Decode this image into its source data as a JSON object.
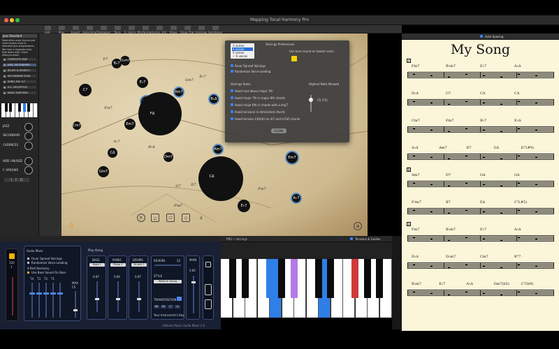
{
  "window": {
    "title": "Mapping Tonal Harmony Pro"
  },
  "toolbar": {
    "items": [
      "Edit",
      "Play",
      "Export",
      "Auto-Arrange",
      "Transpose",
      "Tools",
      "E. Harm. Markers",
      "Performance",
      "Lyrics, Info",
      "Show",
      "Show Transposition",
      "Voicings",
      "Semitones"
    ]
  },
  "left_panel": {
    "song": "Jazz Standard",
    "help": "Most often used chords and chord scales used in standard jazz progressions. We have a separate map that deals with 'Giant' idiosyncrasies.",
    "menu": [
      "COMPLETE MAP",
      "ADV. SECONDARY",
      "BLUES & MODES+",
      "SECONDARY DOM.",
      "SUBS, INC. b7",
      "II-V, DECEPTIVE",
      "BASIC DIATONIC"
    ],
    "active_menu_index": 1,
    "labels": {
      "jazz": "JAZZ",
      "secondary": "SECONDARY",
      "cadences": "CADENCES",
      "hide_unused": "HIDE UNUSED",
      "arrows": "F. ARROWS"
    },
    "bottom_values": [
      "1",
      "2",
      "15"
    ]
  },
  "map": {
    "chords": [
      {
        "label": "F7",
        "style": "light"
      },
      {
        "label": "B♭7",
        "style": "dark"
      },
      {
        "label": "D♭m7",
        "style": "dark"
      },
      {
        "label": "E♭7",
        "style": "dark"
      },
      {
        "label": "Dm7",
        "style": "ring"
      },
      {
        "label": "G♭7",
        "style": "ring"
      },
      {
        "label": "Am7",
        "style": "ring"
      },
      {
        "label": "Gm7",
        "style": "light"
      },
      {
        "label": "E♭7",
        "style": "light"
      },
      {
        "label": "C7",
        "style": "dark"
      },
      {
        "label": "Fm7",
        "style": "light"
      },
      {
        "label": "B♭Δ",
        "style": "ring"
      },
      {
        "label": "Em7",
        "style": "dark"
      },
      {
        "label": "A♭7",
        "style": "light"
      },
      {
        "label": "CΔ",
        "style": "dark"
      },
      {
        "label": "Gm7",
        "style": "dark"
      },
      {
        "label": "B♭Δ",
        "style": "light"
      },
      {
        "label": "Dm7",
        "style": "dark"
      },
      {
        "label": "D7",
        "style": "light"
      },
      {
        "label": "Am7",
        "style": "ring"
      },
      {
        "label": "Em7",
        "style": "ring"
      },
      {
        "label": "C6",
        "style": "light"
      },
      {
        "label": "G7",
        "style": "light"
      },
      {
        "label": "F♯ø7",
        "style": "light"
      },
      {
        "label": "E♭7",
        "style": "dark"
      },
      {
        "label": "A♭7",
        "style": "ring"
      },
      {
        "label": "Fm7",
        "style": "light"
      },
      {
        "label": "Cm7",
        "style": "dark"
      }
    ],
    "big_chords": [
      {
        "label": "FΔ"
      },
      {
        "label": "CΔ"
      }
    ],
    "bottom_icons": [
      "R",
      "triangle",
      "pentagon",
      "diamond",
      "anchor"
    ]
  },
  "dialog": {
    "voices": [
      "3 voices",
      "4 voices",
      "5 voices",
      "6 voices"
    ],
    "voices_selected": 1,
    "voices_checked": 3,
    "voicings_preferences": "Voicings Preferences",
    "use_bass_sound": "Use bass sound on lowest voice",
    "favor_spread": "Favor Spread Voicings",
    "randomize": "Randomize Voice-Leading",
    "rules_title": "Voicings Rules",
    "rules": [
      "Avoid root above major 7th",
      "Avoid major 7th in major 6th chords",
      "Avoid major 6th in chords with a maj7",
      "Avoid tensions in diminished chords",
      "Avoid tension 13th(6) on m7 and m7b5 chords"
    ],
    "highest_note_title": "Highest Note Allowed",
    "highest_note_value": "C5 (72)",
    "close_label": "CLOSE"
  },
  "mixer": {
    "header": "Audio Mixer",
    "left_vals": [
      "120",
      "1"
    ],
    "voicing_options": [
      "Favor Spread Voicings",
      "Randomize Voice-Leading"
    ],
    "harmony_mode": "4-Part Harmony",
    "bass_sound": "Use Bass Sound On Bass",
    "fader_labels": [
      "T4",
      "T3",
      "T2",
      "T1"
    ],
    "max_label": "MAX",
    "max_value": "C5",
    "play_along": "Play Along",
    "instruments": [
      {
        "name": "BASS",
        "preset": "Bass 1",
        "value": "0.87"
      },
      {
        "name": "PIANO",
        "preset": "Piano 1",
        "value": "0.84"
      },
      {
        "name": "DRUMS",
        "preset": "Drums 1",
        "value": "0.87"
      }
    ],
    "reverb": "REVERB",
    "reverb_value": "22",
    "style": "STYLE",
    "style_value": "Medium Swing",
    "transposition": "TRANSPOSITION",
    "transpose_keys": [
      "Bb",
      "Eb",
      "F",
      "A"
    ],
    "instrument_key": "Your Instrument's Key",
    "main": "MAIN",
    "main_value": "0.85",
    "footer": "mDecks Music Audio Mixer 1.0"
  },
  "piano": {
    "bar_label": "PNO • Voicings",
    "tensions_label": "Tensions & Guides",
    "white_keys": 14,
    "highlighted_white": [
      4,
      8
    ],
    "highlighted_black": [
      {
        "index": 2,
        "color": "#2f7fe8"
      },
      {
        "index": 4,
        "color": "#b47be8"
      },
      {
        "index": 7,
        "color": "#cf3a3a"
      }
    ]
  },
  "score": {
    "toolbar_label": "Auto Spacing",
    "title": "My Song",
    "sections": [
      "A",
      "B",
      "A"
    ],
    "lines": [
      {
        "chords": [
          "Fm7",
          "B♭m7",
          "E♭7",
          "A♭Δ"
        ]
      },
      {
        "chords": [
          "D♭Δ",
          "G7",
          "CΔ",
          "CΔ"
        ]
      },
      {
        "chords": [
          "Cm7",
          "Fm7",
          "B♭7",
          "E♭Δ"
        ]
      },
      {
        "chords": [
          "A♭Δ",
          "Am7",
          "D7",
          "GΔ",
          "E7(#9)"
        ]
      },
      {
        "chords": [
          "Am7",
          "D7",
          "GΔ",
          "GΔ"
        ]
      },
      {
        "chords": [
          "F♯m7",
          "B7",
          "EΔ",
          "C7(#5)"
        ]
      },
      {
        "chords": [
          "Fm7",
          "B♭m7",
          "E♭7",
          "A♭Δ"
        ]
      },
      {
        "chords": [
          "D♭Δ",
          "D♭m7",
          "Cm7",
          "B°7"
        ]
      },
      {
        "chords": [
          "B♭m7",
          "E♭7",
          "A♭Δ",
          "Gm7(b5)",
          "C7(b9)"
        ]
      }
    ]
  }
}
